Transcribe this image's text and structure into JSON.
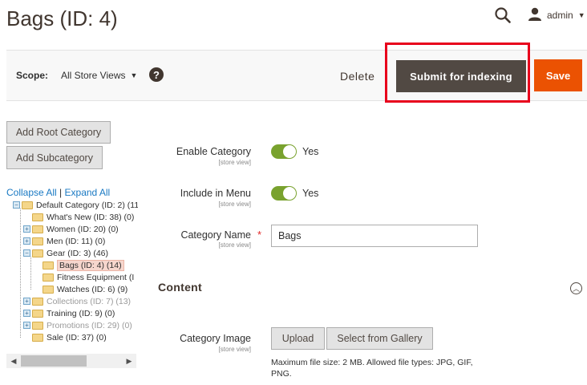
{
  "header": {
    "title": "Bags (ID: 4)",
    "user": "admin"
  },
  "toolbar": {
    "scope_label": "Scope:",
    "scope_value": "All Store Views",
    "help": "?",
    "delete_label": "Delete",
    "submit_label": "Submit for indexing",
    "save_label": "Save"
  },
  "sidebar": {
    "add_root_label": "Add Root Category",
    "add_sub_label": "Add Subcategory",
    "collapse_all": "Collapse All",
    "separator": "|",
    "expand_all": "Expand All",
    "tree": [
      {
        "label": "Default Category (ID: 2) (11",
        "state": "open",
        "level": 0,
        "inactive": false,
        "selected": false
      },
      {
        "label": "What's New (ID: 38) (0)",
        "state": "leaf",
        "level": 1,
        "inactive": false,
        "selected": false
      },
      {
        "label": "Women (ID: 20) (0)",
        "state": "closed",
        "level": 1,
        "inactive": false,
        "selected": false
      },
      {
        "label": "Men (ID: 11) (0)",
        "state": "closed",
        "level": 1,
        "inactive": false,
        "selected": false
      },
      {
        "label": "Gear (ID: 3) (46)",
        "state": "open",
        "level": 1,
        "inactive": false,
        "selected": false
      },
      {
        "label": "Bags (ID: 4) (14)",
        "state": "leaf",
        "level": 2,
        "inactive": false,
        "selected": true
      },
      {
        "label": "Fitness Equipment (I",
        "state": "leaf",
        "level": 2,
        "inactive": false,
        "selected": false
      },
      {
        "label": "Watches (ID: 6) (9)",
        "state": "leaf",
        "level": 2,
        "inactive": false,
        "selected": false
      },
      {
        "label": "Collections (ID: 7) (13)",
        "state": "closed",
        "level": 1,
        "inactive": true,
        "selected": false
      },
      {
        "label": "Training (ID: 9) (0)",
        "state": "closed",
        "level": 1,
        "inactive": false,
        "selected": false
      },
      {
        "label": "Promotions (ID: 29) (0)",
        "state": "closed",
        "level": 1,
        "inactive": true,
        "selected": false
      },
      {
        "label": "Sale (ID: 37) (0)",
        "state": "leaf",
        "level": 1,
        "inactive": false,
        "selected": false
      }
    ]
  },
  "form": {
    "enable_category": {
      "label": "Enable Category",
      "scope": "[store view]",
      "value": "Yes"
    },
    "include_in_menu": {
      "label": "Include in Menu",
      "scope": "[store view]",
      "value": "Yes"
    },
    "category_name": {
      "label": "Category Name",
      "scope": "[store view]",
      "value": "Bags",
      "required": "*"
    },
    "content_title": "Content",
    "category_image": {
      "label": "Category Image",
      "scope": "[store view]",
      "upload_label": "Upload",
      "gallery_label": "Select from Gallery",
      "note": "Maximum file size: 2 MB. Allowed file types: JPG, GIF, PNG."
    }
  },
  "colors": {
    "save": "#eb5202",
    "submit": "#514943",
    "highlight": "#e8001c",
    "toggle_on": "#79a22e",
    "link": "#1979c3"
  }
}
